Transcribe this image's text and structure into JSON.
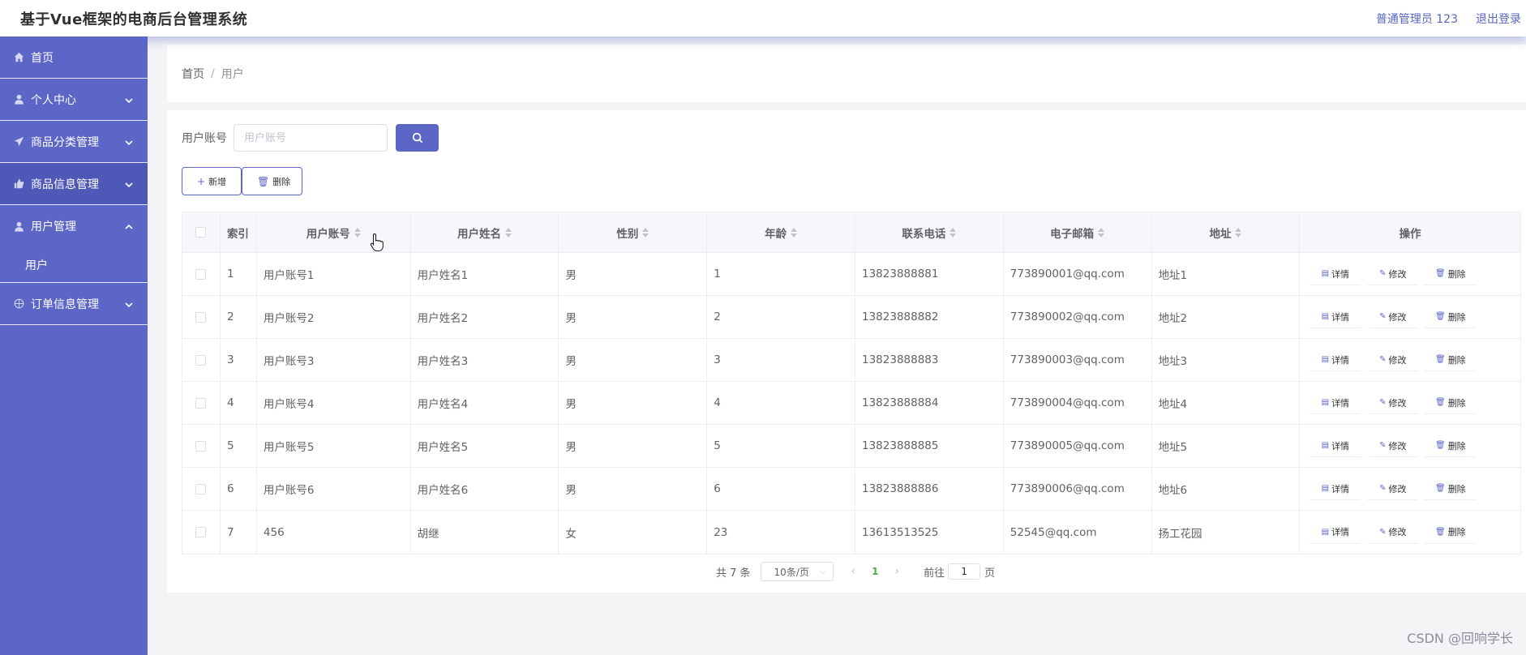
{
  "header": {
    "title": "基于Vue框架的电商后台管理系统",
    "user": "普通管理员 123",
    "logout": "退出登录"
  },
  "sidebar": {
    "items": [
      {
        "label": "首页",
        "icon": "home-icon"
      },
      {
        "label": "个人中心",
        "icon": "user-icon"
      },
      {
        "label": "商品分类管理",
        "icon": "send-icon"
      },
      {
        "label": "商品信息管理",
        "icon": "thumb-icon"
      },
      {
        "label": "用户管理",
        "icon": "user-icon"
      },
      {
        "label": "用户"
      },
      {
        "label": "订单信息管理",
        "icon": "basketball-icon"
      }
    ]
  },
  "breadcrumb": {
    "home": "首页",
    "separator": "/",
    "current": "用户"
  },
  "search": {
    "label": "用户账号",
    "placeholder": "用户账号"
  },
  "actions": {
    "add": "新增",
    "delete": "删除"
  },
  "table": {
    "headers": [
      "索引",
      "用户账号",
      "用户姓名",
      "性别",
      "年龄",
      "联系电话",
      "电子邮箱",
      "地址",
      "操作"
    ],
    "rows": [
      [
        "1",
        "用户账号1",
        "用户姓名1",
        "男",
        "1",
        "13823888881",
        "773890001@qq.com",
        "地址1"
      ],
      [
        "2",
        "用户账号2",
        "用户姓名2",
        "男",
        "2",
        "13823888882",
        "773890002@qq.com",
        "地址2"
      ],
      [
        "3",
        "用户账号3",
        "用户姓名3",
        "男",
        "3",
        "13823888883",
        "773890003@qq.com",
        "地址3"
      ],
      [
        "4",
        "用户账号4",
        "用户姓名4",
        "男",
        "4",
        "13823888884",
        "773890004@qq.com",
        "地址4"
      ],
      [
        "5",
        "用户账号5",
        "用户姓名5",
        "男",
        "5",
        "13823888885",
        "773890005@qq.com",
        "地址5"
      ],
      [
        "6",
        "用户账号6",
        "用户姓名6",
        "男",
        "6",
        "13823888886",
        "773890006@qq.com",
        "地址6"
      ],
      [
        "7",
        "456",
        "胡继",
        "女",
        "23",
        "13613513525",
        "52545@qq.com",
        "扬工花园"
      ]
    ],
    "row_actions": [
      "详情",
      "修改",
      "删除"
    ]
  },
  "pager": {
    "total": "共 7 条",
    "page_size": "10条/页",
    "current_page": "1",
    "goto_prefix": "前往",
    "goto_value": "1",
    "goto_suffix": "页"
  },
  "watermark": "CSDN @回响学长",
  "colors": {
    "accent": "#5b66c6",
    "sidebar": "#5b66c6",
    "active_page": "#4cae4c"
  }
}
